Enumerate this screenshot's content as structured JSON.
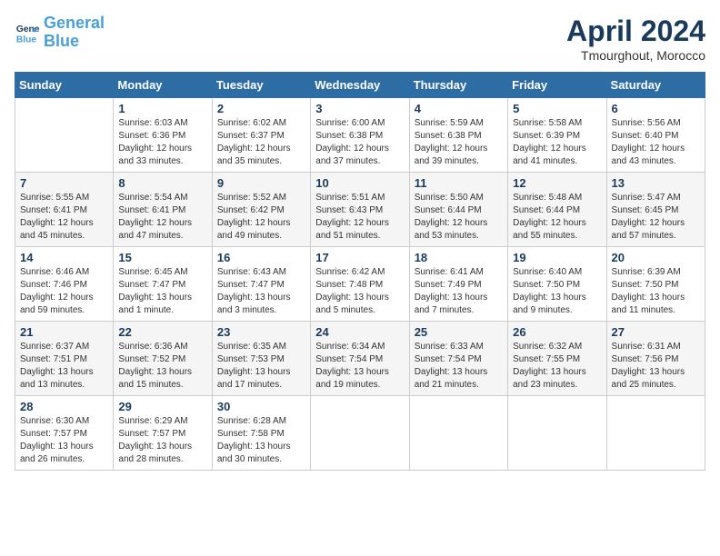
{
  "logo": {
    "line1": "General",
    "line2": "Blue"
  },
  "title": "April 2024",
  "subtitle": "Tmourghout, Morocco",
  "headers": [
    "Sunday",
    "Monday",
    "Tuesday",
    "Wednesday",
    "Thursday",
    "Friday",
    "Saturday"
  ],
  "weeks": [
    [
      {
        "day": "",
        "info": ""
      },
      {
        "day": "1",
        "info": "Sunrise: 6:03 AM\nSunset: 6:36 PM\nDaylight: 12 hours\nand 33 minutes."
      },
      {
        "day": "2",
        "info": "Sunrise: 6:02 AM\nSunset: 6:37 PM\nDaylight: 12 hours\nand 35 minutes."
      },
      {
        "day": "3",
        "info": "Sunrise: 6:00 AM\nSunset: 6:38 PM\nDaylight: 12 hours\nand 37 minutes."
      },
      {
        "day": "4",
        "info": "Sunrise: 5:59 AM\nSunset: 6:38 PM\nDaylight: 12 hours\nand 39 minutes."
      },
      {
        "day": "5",
        "info": "Sunrise: 5:58 AM\nSunset: 6:39 PM\nDaylight: 12 hours\nand 41 minutes."
      },
      {
        "day": "6",
        "info": "Sunrise: 5:56 AM\nSunset: 6:40 PM\nDaylight: 12 hours\nand 43 minutes."
      }
    ],
    [
      {
        "day": "7",
        "info": "Sunrise: 5:55 AM\nSunset: 6:41 PM\nDaylight: 12 hours\nand 45 minutes."
      },
      {
        "day": "8",
        "info": "Sunrise: 5:54 AM\nSunset: 6:41 PM\nDaylight: 12 hours\nand 47 minutes."
      },
      {
        "day": "9",
        "info": "Sunrise: 5:52 AM\nSunset: 6:42 PM\nDaylight: 12 hours\nand 49 minutes."
      },
      {
        "day": "10",
        "info": "Sunrise: 5:51 AM\nSunset: 6:43 PM\nDaylight: 12 hours\nand 51 minutes."
      },
      {
        "day": "11",
        "info": "Sunrise: 5:50 AM\nSunset: 6:44 PM\nDaylight: 12 hours\nand 53 minutes."
      },
      {
        "day": "12",
        "info": "Sunrise: 5:48 AM\nSunset: 6:44 PM\nDaylight: 12 hours\nand 55 minutes."
      },
      {
        "day": "13",
        "info": "Sunrise: 5:47 AM\nSunset: 6:45 PM\nDaylight: 12 hours\nand 57 minutes."
      }
    ],
    [
      {
        "day": "14",
        "info": "Sunrise: 6:46 AM\nSunset: 7:46 PM\nDaylight: 12 hours\nand 59 minutes."
      },
      {
        "day": "15",
        "info": "Sunrise: 6:45 AM\nSunset: 7:47 PM\nDaylight: 13 hours\nand 1 minute."
      },
      {
        "day": "16",
        "info": "Sunrise: 6:43 AM\nSunset: 7:47 PM\nDaylight: 13 hours\nand 3 minutes."
      },
      {
        "day": "17",
        "info": "Sunrise: 6:42 AM\nSunset: 7:48 PM\nDaylight: 13 hours\nand 5 minutes."
      },
      {
        "day": "18",
        "info": "Sunrise: 6:41 AM\nSunset: 7:49 PM\nDaylight: 13 hours\nand 7 minutes."
      },
      {
        "day": "19",
        "info": "Sunrise: 6:40 AM\nSunset: 7:50 PM\nDaylight: 13 hours\nand 9 minutes."
      },
      {
        "day": "20",
        "info": "Sunrise: 6:39 AM\nSunset: 7:50 PM\nDaylight: 13 hours\nand 11 minutes."
      }
    ],
    [
      {
        "day": "21",
        "info": "Sunrise: 6:37 AM\nSunset: 7:51 PM\nDaylight: 13 hours\nand 13 minutes."
      },
      {
        "day": "22",
        "info": "Sunrise: 6:36 AM\nSunset: 7:52 PM\nDaylight: 13 hours\nand 15 minutes."
      },
      {
        "day": "23",
        "info": "Sunrise: 6:35 AM\nSunset: 7:53 PM\nDaylight: 13 hours\nand 17 minutes."
      },
      {
        "day": "24",
        "info": "Sunrise: 6:34 AM\nSunset: 7:54 PM\nDaylight: 13 hours\nand 19 minutes."
      },
      {
        "day": "25",
        "info": "Sunrise: 6:33 AM\nSunset: 7:54 PM\nDaylight: 13 hours\nand 21 minutes."
      },
      {
        "day": "26",
        "info": "Sunrise: 6:32 AM\nSunset: 7:55 PM\nDaylight: 13 hours\nand 23 minutes."
      },
      {
        "day": "27",
        "info": "Sunrise: 6:31 AM\nSunset: 7:56 PM\nDaylight: 13 hours\nand 25 minutes."
      }
    ],
    [
      {
        "day": "28",
        "info": "Sunrise: 6:30 AM\nSunset: 7:57 PM\nDaylight: 13 hours\nand 26 minutes."
      },
      {
        "day": "29",
        "info": "Sunrise: 6:29 AM\nSunset: 7:57 PM\nDaylight: 13 hours\nand 28 minutes."
      },
      {
        "day": "30",
        "info": "Sunrise: 6:28 AM\nSunset: 7:58 PM\nDaylight: 13 hours\nand 30 minutes."
      },
      {
        "day": "",
        "info": ""
      },
      {
        "day": "",
        "info": ""
      },
      {
        "day": "",
        "info": ""
      },
      {
        "day": "",
        "info": ""
      }
    ]
  ]
}
